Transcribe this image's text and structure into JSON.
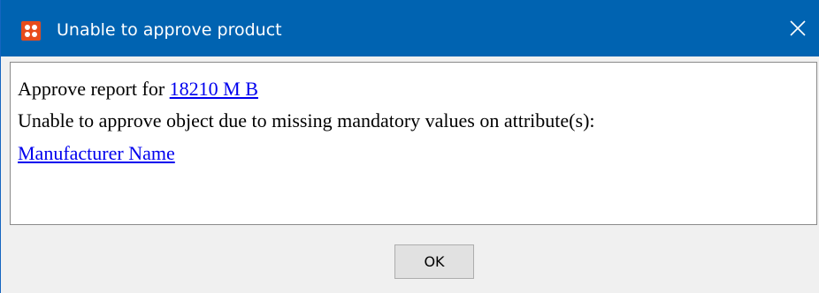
{
  "window": {
    "title": "Unable to approve product",
    "app_icon": "grid-app-icon",
    "close_icon": "close-icon",
    "titlebar_color": "#0063b1"
  },
  "message": {
    "line1_prefix": "Approve report for ",
    "report_link": "18210 M B",
    "line2": "Unable to approve object due to missing mandatory values on attribute(s):",
    "attribute_link": "Manufacturer Name",
    "link_color": "#0000ee"
  },
  "buttons": {
    "ok_label": "OK"
  }
}
